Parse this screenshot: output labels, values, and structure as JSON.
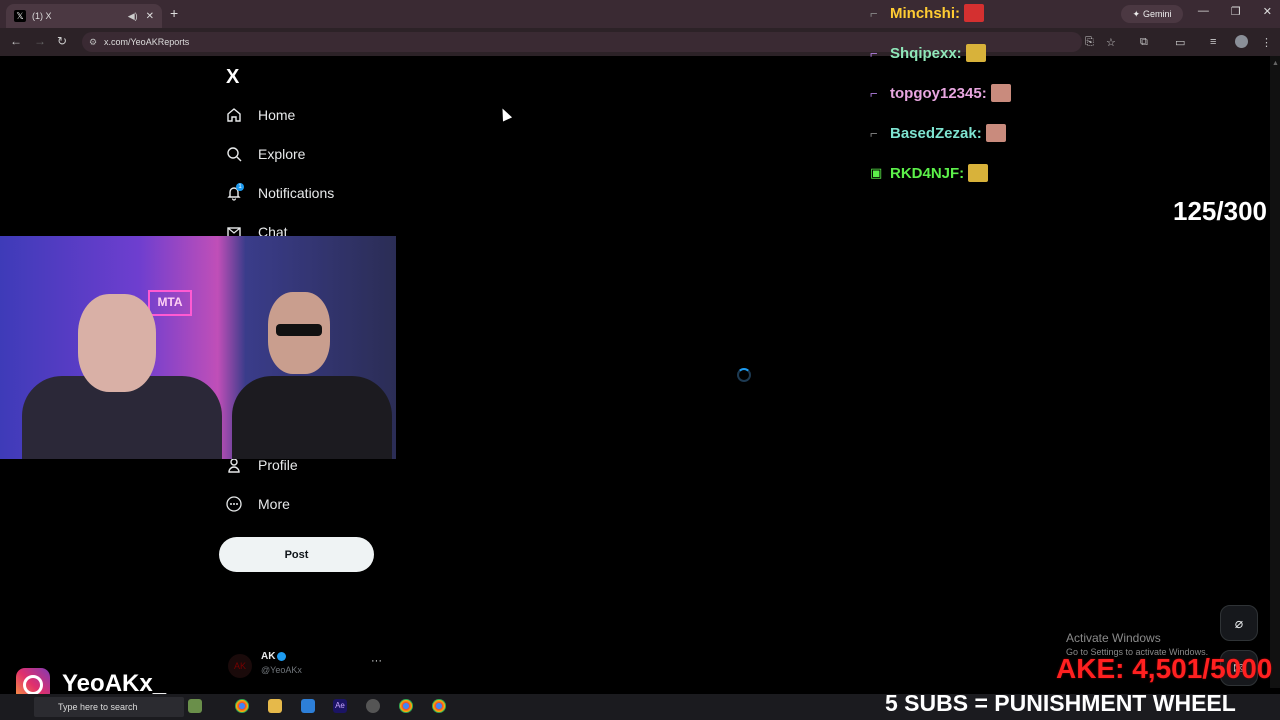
{
  "browser": {
    "tab_title": "(1) X",
    "new_tab_glyph": "+",
    "gemini_label": "Gemini",
    "url": "x.com/YeoAKReports",
    "window_buttons": [
      "—",
      "❐",
      "✕"
    ]
  },
  "sidebar": {
    "logo": "X",
    "items": [
      {
        "label": "Home",
        "icon": "home-icon"
      },
      {
        "label": "Explore",
        "icon": "search-icon"
      },
      {
        "label": "Notifications",
        "icon": "bell-icon"
      },
      {
        "label": "Chat",
        "icon": "mail-icon"
      },
      {
        "label": "Profile",
        "icon": "person-icon"
      },
      {
        "label": "More",
        "icon": "more-circle-icon"
      }
    ],
    "notification_count": "1",
    "post_button": "Post"
  },
  "account": {
    "name": "AK",
    "handle": "@YeoAKx",
    "more": "···"
  },
  "chat": [
    {
      "user": "Minchshi:",
      "color": "#ffcc33",
      "symbol": "⌐",
      "emote_color": "#d43030"
    },
    {
      "user": "Shqipexx:",
      "color": "#8fe7b9",
      "symbol": "⌐",
      "emote_color": "#d8b23a"
    },
    {
      "user": "topgoy12345:",
      "color": "#e8a6e0",
      "symbol": "⌐",
      "emote_color": "#c98b7d"
    },
    {
      "user": "BasedZezak:",
      "color": "#7ee3d0",
      "symbol": "⌐",
      "emote_color": "#c98b7d"
    },
    {
      "user": "RKD4NJF:",
      "color": "#5cf04a",
      "symbol": "▣",
      "emote_color": "#d8b23a"
    }
  ],
  "goal_counter": "125/300",
  "watermark": {
    "title": "Activate Windows",
    "subtitle": "Go to Settings to activate Windows."
  },
  "ake_counter": "AKE: 4,501/5000",
  "subs_banner": "5 SUBS = PUNISHMENT WHEEL",
  "webcam_sign": "MTA",
  "instagram_handle": "YeoAKx_",
  "taskbar": {
    "search_placeholder": "Type here to search"
  },
  "colors": {
    "accent": "#1d9bf0",
    "ake": "#ff2020",
    "background": "#000000"
  }
}
